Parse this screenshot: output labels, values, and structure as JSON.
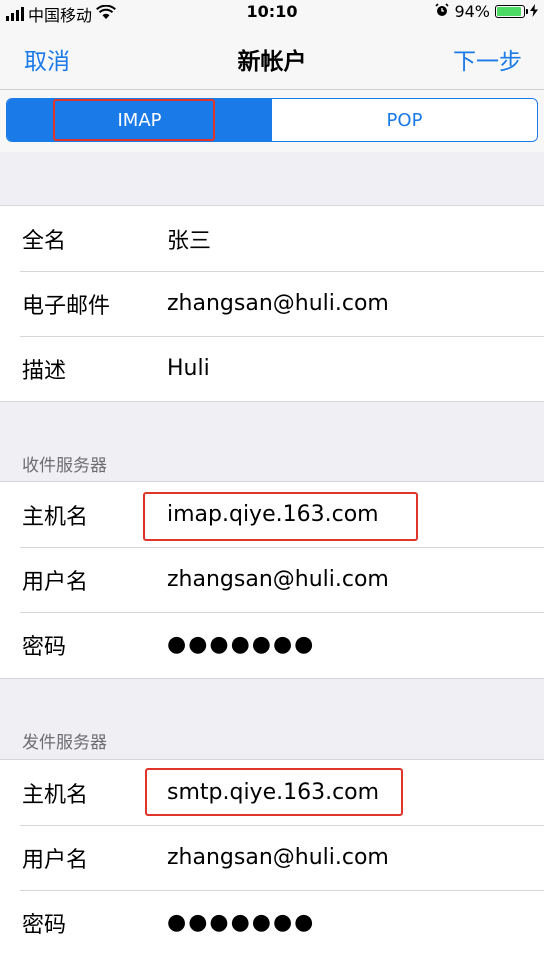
{
  "status_bar": {
    "carrier": "中国移动",
    "time": "10:10",
    "battery_percent": "94%",
    "battery_level": 0.94
  },
  "nav": {
    "cancel": "取消",
    "title": "新帐户",
    "next": "下一步"
  },
  "segments": {
    "imap": "IMAP",
    "pop": "POP",
    "selected": "IMAP"
  },
  "account": {
    "fullname_label": "全名",
    "fullname_value": "张三",
    "email_label": "电子邮件",
    "email_value": "zhangsan@huli.com",
    "description_label": "描述",
    "description_value": "Huli"
  },
  "incoming": {
    "header": "收件服务器",
    "host_label": "主机名",
    "host_value": "imap.qiye.163.com",
    "user_label": "用户名",
    "user_value": "zhangsan@huli.com",
    "password_label": "密码",
    "password_value": "●●●●●●●"
  },
  "outgoing": {
    "header": "发件服务器",
    "host_label": "主机名",
    "host_value": "smtp.qiye.163.com",
    "user_label": "用户名",
    "user_value": "zhangsan@huli.com",
    "password_label": "密码",
    "password_value": "●●●●●●●"
  },
  "colors": {
    "accent": "#1a7ae8",
    "highlight": "#e0352b",
    "background": "#efeff4"
  }
}
